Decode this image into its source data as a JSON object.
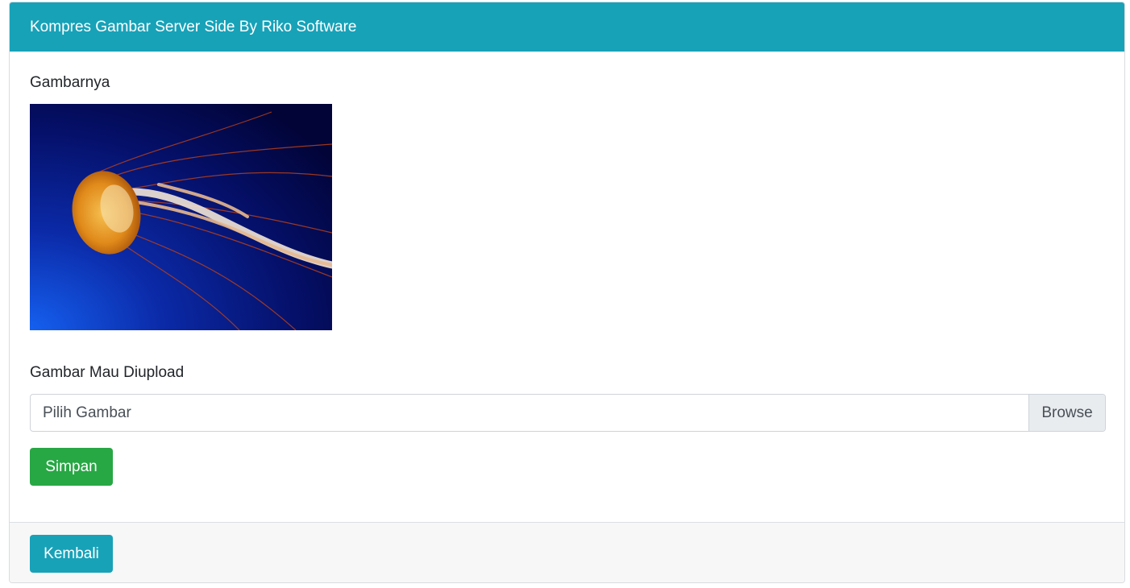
{
  "header": {
    "title": "Kompres Gambar Server Side By Riko Software"
  },
  "form": {
    "image_label": "Gambarnya",
    "upload_label": "Gambar Mau Diupload",
    "file_placeholder": "Pilih Gambar",
    "browse_label": "Browse",
    "save_label": "Simpan"
  },
  "footer": {
    "back_label": "Kembali"
  },
  "colors": {
    "header_bg": "#17a2b8",
    "save_bg": "#28a745",
    "back_bg": "#17a2b8"
  },
  "image": {
    "subject": "jellyfish-photo"
  }
}
